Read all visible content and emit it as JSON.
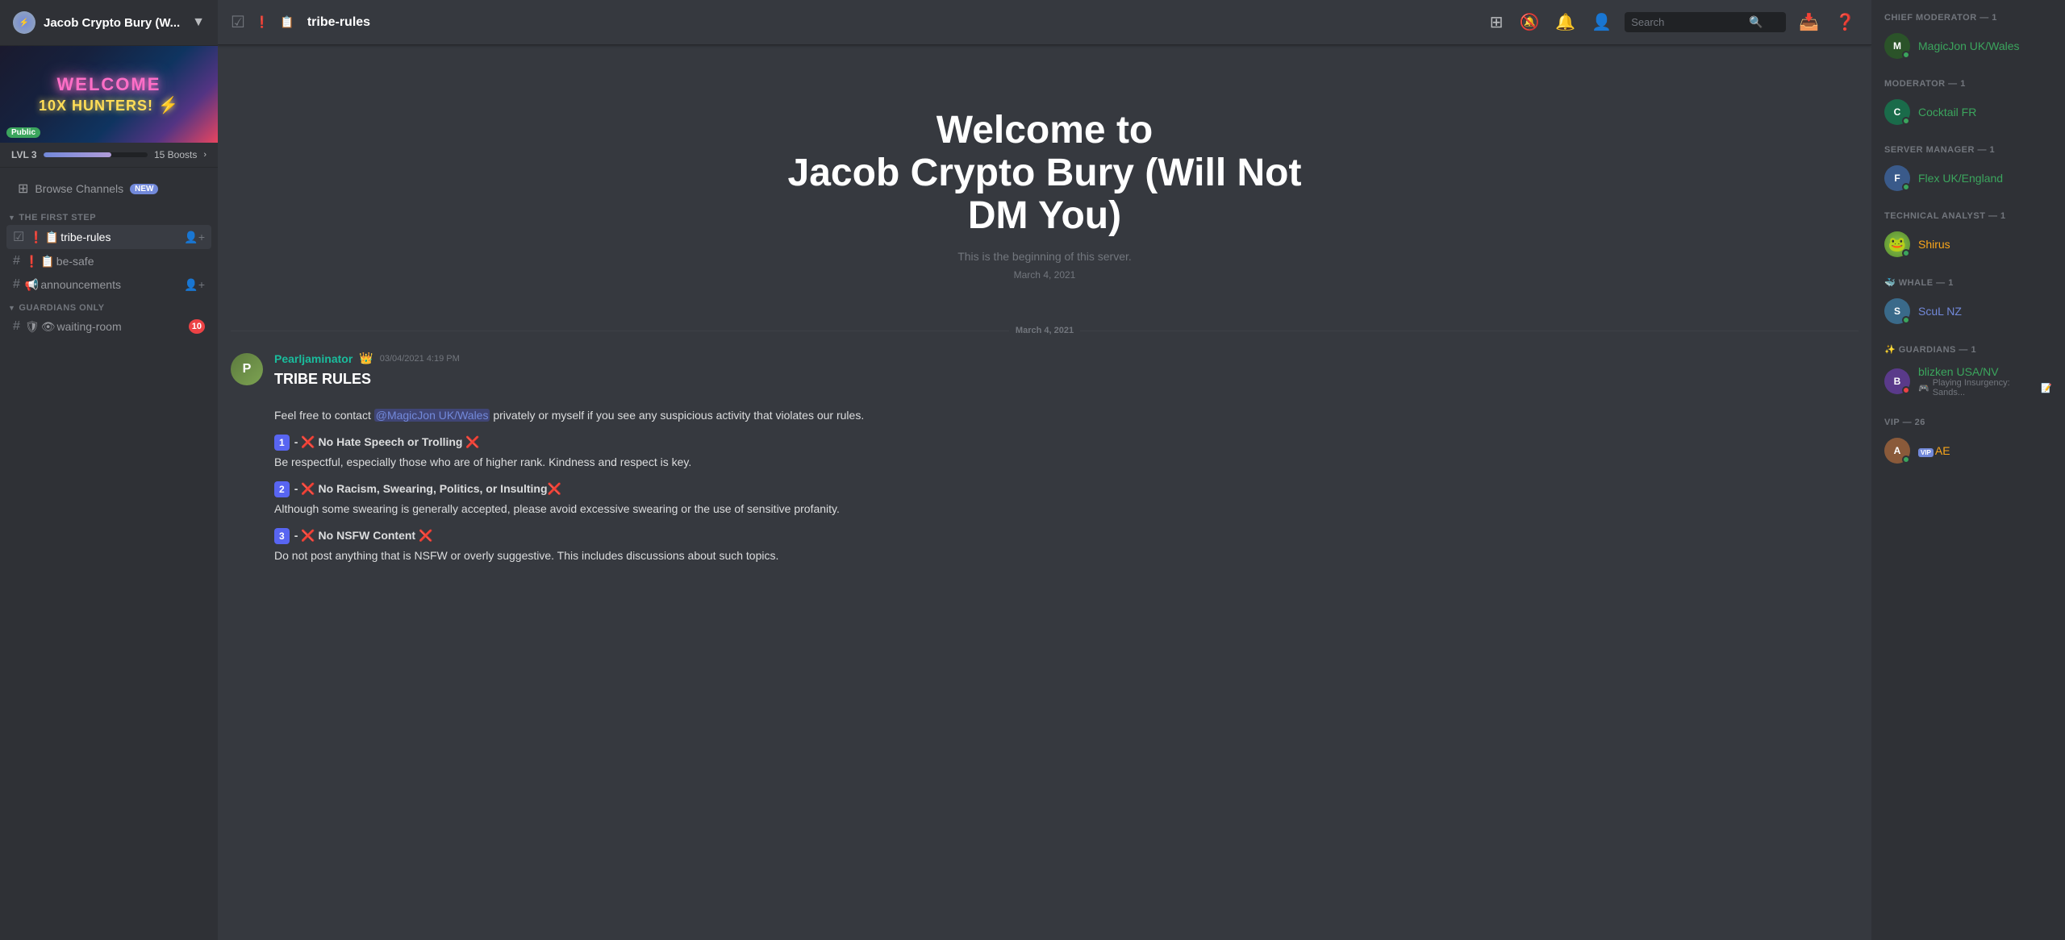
{
  "server": {
    "name": "Jacob Crypto Bury (W...",
    "public": "Public",
    "banner_line1": "WELCOME",
    "banner_line2": "10X HUNTERS!",
    "lvl": "LVL 3",
    "boosts": "15 Boosts",
    "boost_progress": 65
  },
  "sidebar": {
    "browse_channels": "Browse Channels",
    "browse_channels_badge": "NEW",
    "sections": [
      {
        "name": "THE FIRST STEP",
        "channels": [
          {
            "type": "text",
            "name": "tribe-rules",
            "prefix": "#",
            "active": true,
            "icon": "📋",
            "rules_icon": true
          },
          {
            "type": "text",
            "name": "be-safe",
            "prefix": "#",
            "icon": "⚠️"
          }
        ]
      },
      {
        "name": "THE FIRST STEP",
        "channels": [
          {
            "type": "text",
            "name": "announcements",
            "prefix": "#",
            "icon": "📢"
          }
        ]
      },
      {
        "name": "GUARDIANS ONLY",
        "channels": [
          {
            "type": "text",
            "name": "waiting-room",
            "prefix": "#",
            "badge": 10,
            "icon": "🛡️"
          }
        ]
      }
    ]
  },
  "header": {
    "channel_name": "tribe-rules",
    "search_placeholder": "Search",
    "actions": [
      "hashtag",
      "bell-slash",
      "notification",
      "person",
      "search",
      "inbox",
      "help"
    ]
  },
  "welcome": {
    "title_line1": "Welcome to",
    "title_line2": "Jacob Crypto Bury (Will Not",
    "title_line3": "DM You)",
    "subtitle": "This is the beginning of this server.",
    "date": "March 4, 2021"
  },
  "message": {
    "author": "Pearljaminator",
    "timestamp": "03/04/2021 4:19 PM",
    "crown_emoji": "👑",
    "heading": "TRIBE RULES",
    "intro": "Feel free to contact",
    "mention": "@MagicJon UK/Wales",
    "intro_rest": "privately or myself if you see any suspicious activity that violates our rules.",
    "rules": [
      {
        "num": "1",
        "title": "❌ No Hate Speech or Trolling ❌",
        "desc": "Be respectful, especially those who are of higher rank. Kindness and respect is key."
      },
      {
        "num": "2",
        "title": "❌ No Racism, Swearing, Politics, or Insulting❌",
        "desc": "Although some swearing is generally accepted, please avoid excessive swearing or the use of sensitive profanity."
      },
      {
        "num": "3",
        "title": "❌ No NSFW Content ❌",
        "desc": "Do not post anything that is NSFW or overly suggestive. This includes discussions about such topics."
      }
    ]
  },
  "members": {
    "roles": [
      {
        "role_name": "CHIEF MODERATOR — 1",
        "members": [
          {
            "name": "MagicJon UK/Wales",
            "color": "green",
            "status": "online",
            "avatar_color": "#2b5329",
            "avatar_letter": "M"
          }
        ]
      },
      {
        "role_name": "MODERATOR — 1",
        "members": [
          {
            "name": "Cocktail FR",
            "color": "green",
            "status": "online",
            "avatar_color": "#1a6b4a",
            "avatar_letter": "C"
          }
        ]
      },
      {
        "role_name": "SERVER MANAGER — 1",
        "members": [
          {
            "name": "Flex UK/England",
            "color": "green",
            "status": "online",
            "avatar_color": "#3a5a8a",
            "avatar_letter": "F"
          }
        ]
      },
      {
        "role_name": "TECHNICAL ANALYST — 1",
        "members": [
          {
            "name": "Shirus",
            "color": "yellow",
            "status": "online",
            "avatar_color": "#5a8a3a",
            "avatar_letter": "S"
          }
        ]
      },
      {
        "role_name": "WHALE — 1",
        "members": [
          {
            "name": "ScuL NZ",
            "color": "blue",
            "status": "online",
            "avatar_color": "#3a6a8a",
            "avatar_letter": "S"
          }
        ]
      },
      {
        "role_name": "GUARDIANS — 1",
        "members": [
          {
            "name": "blizken USA/NV",
            "color": "green",
            "status": "dnd",
            "avatar_color": "#5a3a8a",
            "avatar_letter": "B",
            "subtext": "Playing Insurgency: Sands...",
            "has_note_icon": true
          }
        ]
      },
      {
        "role_name": "VIP — 26",
        "members": [
          {
            "name": "AE",
            "color": "yellow",
            "status": "online",
            "avatar_color": "#8a5a3a",
            "avatar_letter": "A",
            "is_vip": true
          }
        ]
      }
    ]
  },
  "divider_date": "March 4, 2021"
}
